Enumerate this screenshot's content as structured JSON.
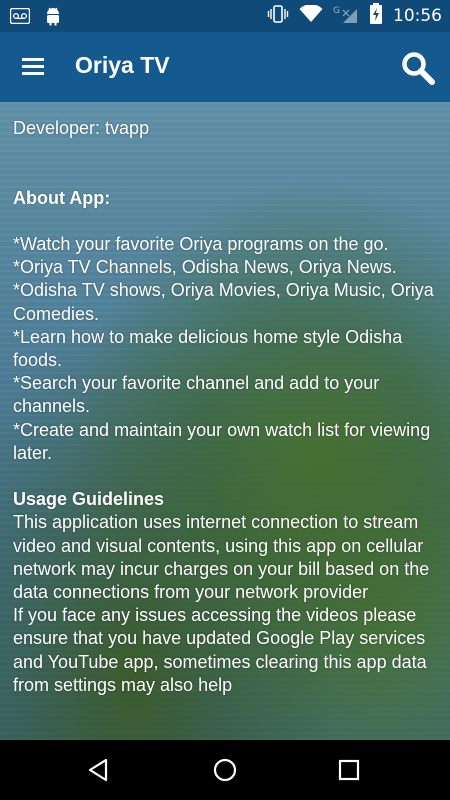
{
  "status_bar": {
    "time": "10:56",
    "left_icons": [
      "voicemail-icon",
      "android-icon"
    ],
    "right_icons": [
      "vibrate-icon",
      "wifi-icon",
      "signal-icon",
      "battery-charging-icon"
    ]
  },
  "app_bar": {
    "title": "Oriya TV",
    "menu_icon": "hamburger-menu-icon",
    "search_icon": "search-icon"
  },
  "content": {
    "developer": "Developer: tvapp",
    "about_heading": "About App:",
    "about_items": [
      "*Watch your favorite Oriya programs on the go.",
      "*Oriya TV Channels, Odisha News, Oriya News.",
      "*Odisha TV shows, Oriya Movies, Oriya Music, Oriya Comedies.",
      "*Learn how to make delicious home style Odisha foods.",
      "*Search your favorite channel and add to your channels.",
      "*Create and maintain your own watch list for viewing later."
    ],
    "usage_heading": "Usage Guidelines",
    "usage_p1": "This application uses internet connection to stream video and visual contents, using this app on cellular network may incur charges on your bill based on the data connections from your network provider",
    "usage_p2": "If you face any issues accessing the videos please ensure that you have updated Google Play services and YouTube app, sometimes clearing this app data from settings may also help"
  },
  "nav_bar": {
    "icons": [
      "back-icon",
      "home-icon",
      "recents-icon"
    ]
  },
  "colors": {
    "status_bar": "#0f4a78",
    "app_bar": "#155a8f",
    "nav_bar": "#000000",
    "text": "#ffffff"
  }
}
